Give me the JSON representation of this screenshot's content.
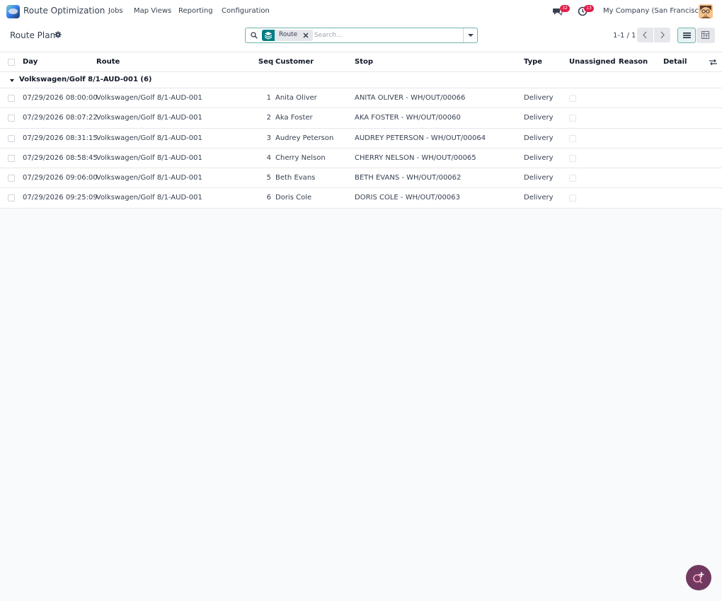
{
  "navbar": {
    "app_name": "Route Optimization",
    "menu": [
      "Jobs",
      "Map Views",
      "Reporting",
      "Configuration"
    ],
    "messages_count": "32",
    "activities_count": "13",
    "company": "My Company (San Francisco)"
  },
  "control_panel": {
    "title": "Route Plan",
    "search": {
      "facet_label": "Route",
      "placeholder": "Search..."
    },
    "pager": "1-1 / 1"
  },
  "table": {
    "columns": {
      "day": "Day",
      "route": "Route",
      "seq": "Seq",
      "customer": "Customer",
      "stop": "Stop",
      "type": "Type",
      "unassigned": "Unassigned",
      "reason": "Reason",
      "detail": "Detail"
    },
    "group_label": "Volkswagen/Golf 8/1-AUD-001 (6)",
    "rows": [
      {
        "day": "07/29/2026 08:00:00",
        "route": "Volkswagen/Golf 8/1-AUD-001",
        "seq": "1",
        "customer": "Anita Oliver",
        "stop": "ANITA OLIVER - WH/OUT/00066",
        "type": "Delivery",
        "reason": "",
        "detail": ""
      },
      {
        "day": "07/29/2026 08:07:22",
        "route": "Volkswagen/Golf 8/1-AUD-001",
        "seq": "2",
        "customer": "Aka Foster",
        "stop": "AKA FOSTER - WH/OUT/00060",
        "type": "Delivery",
        "reason": "",
        "detail": ""
      },
      {
        "day": "07/29/2026 08:31:15",
        "route": "Volkswagen/Golf 8/1-AUD-001",
        "seq": "3",
        "customer": "Audrey Peterson",
        "stop": "AUDREY PETERSON - WH/OUT/00064",
        "type": "Delivery",
        "reason": "",
        "detail": ""
      },
      {
        "day": "07/29/2026 08:58:45",
        "route": "Volkswagen/Golf 8/1-AUD-001",
        "seq": "4",
        "customer": "Cherry Nelson",
        "stop": "CHERRY NELSON - WH/OUT/00065",
        "type": "Delivery",
        "reason": "",
        "detail": ""
      },
      {
        "day": "07/29/2026 09:06:00",
        "route": "Volkswagen/Golf 8/1-AUD-001",
        "seq": "5",
        "customer": "Beth Evans",
        "stop": "BETH EVANS - WH/OUT/00062",
        "type": "Delivery",
        "reason": "",
        "detail": ""
      },
      {
        "day": "07/29/2026 09:25:09",
        "route": "Volkswagen/Golf 8/1-AUD-001",
        "seq": "6",
        "customer": "Doris Cole",
        "stop": "DORIS COLE - WH/OUT/00063",
        "type": "Delivery",
        "reason": "",
        "detail": ""
      }
    ]
  },
  "icons": {
    "app_logo": "route-optimization-logo-icon",
    "messages": "chat-bubbles-icon",
    "activities": "clock-icon",
    "settings": "gear-icon",
    "search": "search-icon",
    "facet": "layers-icon",
    "remove": "close-icon",
    "prev": "chevron-left-icon",
    "next": "chevron-right-icon",
    "list_view": "list-view-icon",
    "pivot_view": "pivot-view-icon",
    "optional_columns": "column-settings-icon",
    "assistant": "assistant-icon"
  },
  "colors": {
    "accent": "#017e84",
    "badge": "#e11d48",
    "fab": "#71395f"
  }
}
